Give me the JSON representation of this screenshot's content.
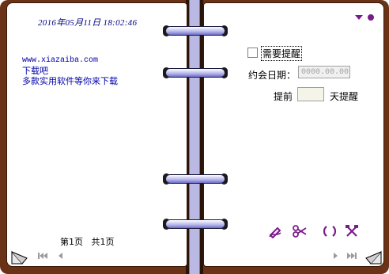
{
  "left_page": {
    "datetime": "2016年05月11日 18:02:46",
    "note_lines": [
      "www.xiazaiba.com",
      "下载吧",
      "多款实用软件等你来下载"
    ],
    "page_current": "第1页",
    "page_total": "共1页"
  },
  "right_page": {
    "need_reminder_label": "需要提醒",
    "need_reminder_checked": false,
    "date_label": "约会日期：",
    "date_placeholder": "0000.00.00",
    "remind_before_label": "提前",
    "remind_days_value": "",
    "remind_days_suffix": "天提醒"
  },
  "toolbar": {
    "icons": [
      "edit-icon",
      "cut-icon",
      "link-icon",
      "tools-icon"
    ]
  },
  "colors": {
    "cover": "#6a3216",
    "ring_blue": "#b9b9e4",
    "text_blue": "#0000aa",
    "accent_purple": "#7a1b8a"
  }
}
